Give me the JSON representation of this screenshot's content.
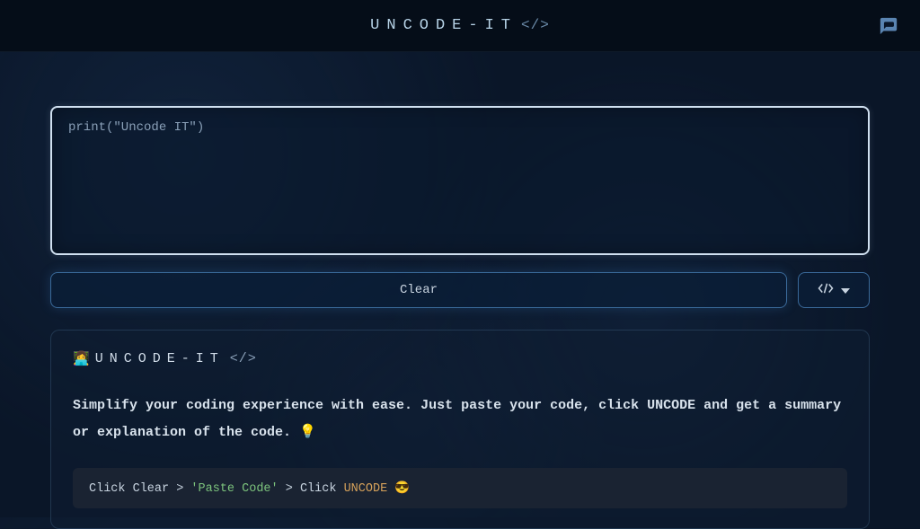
{
  "header": {
    "logo_text": "UNCODE-IT",
    "logo_bracket": "</>"
  },
  "editor": {
    "placeholder": "print(\"Uncode IT\")",
    "value": ""
  },
  "controls": {
    "clear_label": "Clear"
  },
  "info": {
    "emoji": "👩‍💻",
    "title_text": "UNCODE-IT",
    "title_bracket": "</>",
    "description": "Simplify your coding experience with ease. Just paste your code, click UNCODE and get a summary or explanation of the code. 💡",
    "instruction": {
      "part1": "Click Clear > ",
      "paste": "'Paste Code'",
      "part2": " > Click ",
      "uncode": "UNCODE",
      "part3": " 😎"
    }
  }
}
